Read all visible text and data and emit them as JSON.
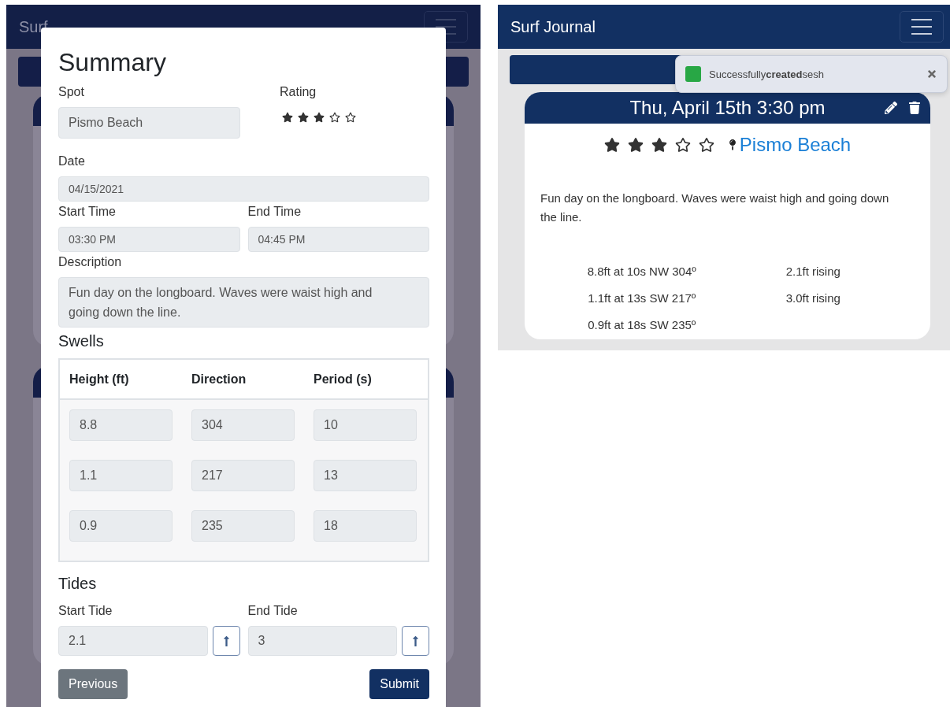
{
  "background_app": {
    "brand": "Surf"
  },
  "modal": {
    "title": "Summary",
    "spot": {
      "label": "Spot",
      "value": "Pismo Beach"
    },
    "rating": {
      "label": "Rating",
      "stars": 3
    },
    "date": {
      "label": "Date",
      "value": "04/15/2021"
    },
    "start_time": {
      "label": "Start Time",
      "value": "03:30 PM"
    },
    "end_time": {
      "label": "End Time",
      "value": "04:45 PM"
    },
    "description": {
      "label": "Description",
      "value": "Fun day on the longboard. Waves were waist high and going down the line."
    },
    "swells": {
      "title": "Swells",
      "columns": [
        "Height (ft)",
        "Direction",
        "Period (s)"
      ],
      "rows": [
        [
          "8.8",
          "304",
          "10"
        ],
        [
          "1.1",
          "217",
          "13"
        ],
        [
          "0.9",
          "235",
          "18"
        ]
      ]
    },
    "tides": {
      "title": "Tides",
      "fields": [
        {
          "label": "Start Tide",
          "value": "2.1"
        },
        {
          "label": "End Tide",
          "value": "3"
        }
      ]
    },
    "buttons": [
      {
        "label": "Previous",
        "kind": "secondary"
      },
      {
        "label": "Submit",
        "kind": "primary"
      }
    ]
  },
  "journal_app": {
    "brand": "Surf Journal",
    "toast": {
      "message": "Successfully**created**sesh"
    },
    "session": {
      "title": "Thu, April 15th 3:30 pm",
      "stars": 3,
      "spot": "Pismo Beach",
      "description": "Fun day on the longboard. Waves were waist high and going down the line.",
      "swells": [
        "8.8ft at 10s NW 304º",
        "1.1ft at 13s SW 217º",
        "0.9ft at 18s SW 235º"
      ],
      "tides": [
        "2.1ft rising",
        "3.0ft rising"
      ]
    }
  }
}
